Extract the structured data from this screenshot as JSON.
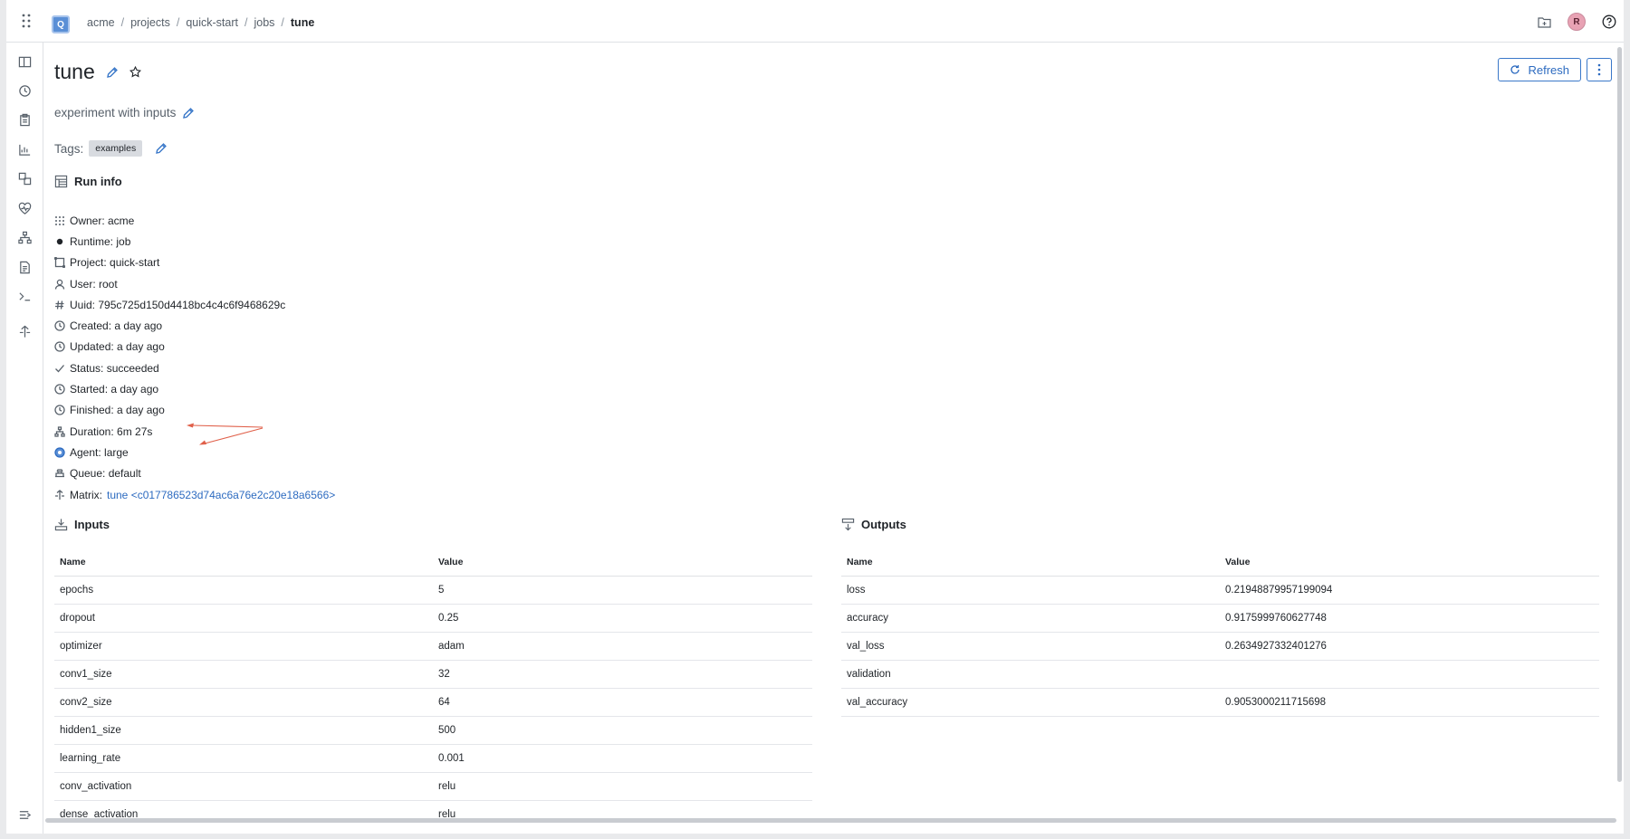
{
  "topbar": {
    "org_initial": "Q",
    "breadcrumb": [
      "acme",
      "projects",
      "quick-start",
      "jobs",
      "tune"
    ],
    "avatar_initial": "R"
  },
  "header": {
    "title": "tune",
    "refresh_label": "Refresh",
    "description": "experiment with inputs",
    "tags_label": "Tags:",
    "tags": [
      "examples"
    ]
  },
  "run_info": {
    "heading": "Run info",
    "rows": [
      {
        "icon": "grid-dots-icon",
        "text": "Owner: acme"
      },
      {
        "icon": "dot-icon",
        "text": "Runtime: job"
      },
      {
        "icon": "project-icon",
        "text": "Project: quick-start"
      },
      {
        "icon": "user-icon",
        "text": "User: root"
      },
      {
        "icon": "hash-icon",
        "text": "Uuid: 795c725d150d4418bc4c4c6f9468629c"
      },
      {
        "icon": "clock-icon",
        "text": "Created: a day ago"
      },
      {
        "icon": "clock-icon",
        "text": "Updated: a day ago"
      },
      {
        "icon": "check-icon",
        "text": "Status: succeeded"
      },
      {
        "icon": "clock-icon",
        "text": "Started: a day ago"
      },
      {
        "icon": "clock-icon",
        "text": "Finished: a day ago"
      },
      {
        "icon": "tree-icon",
        "text": "Duration: 6m 27s"
      },
      {
        "icon": "agent-icon",
        "text": "Agent: large"
      },
      {
        "icon": "queue-icon",
        "text": "Queue: default"
      }
    ],
    "matrix_label": "Matrix:",
    "matrix_link": "tune <c017786523d74ac6a76e2c20e18a6566>"
  },
  "inputs": {
    "heading": "Inputs",
    "columns": [
      "Name",
      "Value"
    ],
    "rows": [
      [
        "epochs",
        "5"
      ],
      [
        "dropout",
        "0.25"
      ],
      [
        "optimizer",
        "adam"
      ],
      [
        "conv1_size",
        "32"
      ],
      [
        "conv2_size",
        "64"
      ],
      [
        "hidden1_size",
        "500"
      ],
      [
        "learning_rate",
        "0.001"
      ],
      [
        "conv_activation",
        "relu"
      ],
      [
        "dense_activation",
        "relu"
      ]
    ]
  },
  "outputs": {
    "heading": "Outputs",
    "columns": [
      "Name",
      "Value"
    ],
    "rows": [
      [
        "loss",
        "0.21948879957199094"
      ],
      [
        "accuracy",
        "0.9175999760627748"
      ],
      [
        "val_loss",
        "0.2634927332401276"
      ],
      [
        "validation",
        ""
      ],
      [
        "val_accuracy",
        "0.9053000211715698"
      ]
    ]
  },
  "colors": {
    "accent": "#2d6bc0",
    "annotation_arrow": "#e0604a"
  }
}
